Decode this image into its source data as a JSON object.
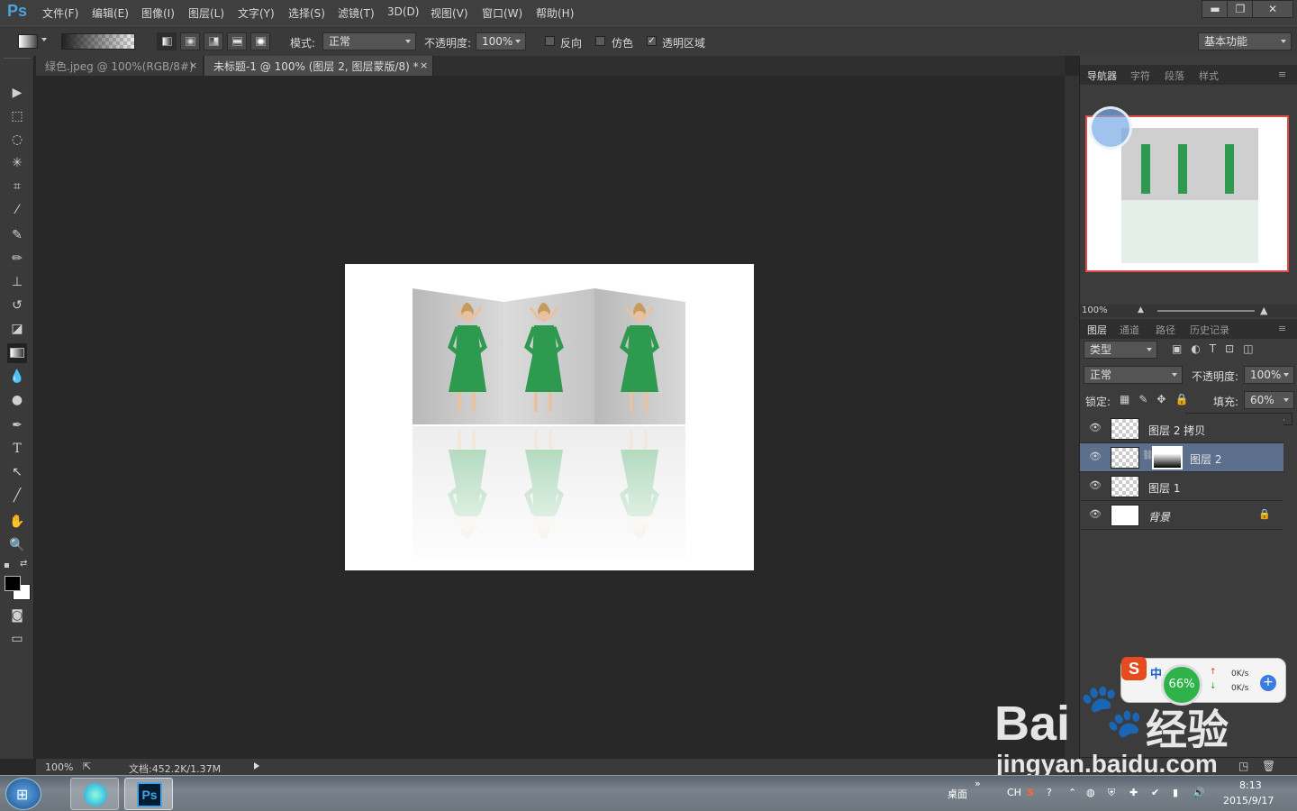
{
  "app": {
    "logo": "Ps"
  },
  "menu": [
    "文件(F)",
    "编辑(E)",
    "图像(I)",
    "图层(L)",
    "文字(Y)",
    "选择(S)",
    "滤镜(T)",
    "3D(D)",
    "视图(V)",
    "窗口(W)",
    "帮助(H)"
  ],
  "window_buttons": {
    "minimize": "▬",
    "restore": "❐",
    "close": "✕"
  },
  "options": {
    "mode_label": "模式:",
    "mode_value": "正常",
    "opacity_label": "不透明度:",
    "opacity_value": "100%",
    "reverse_label": "反向",
    "dither_label": "仿色",
    "transparency_label": "透明区域",
    "workspace": "基本功能"
  },
  "tabs": [
    {
      "label": "绿色.jpeg @ 100%(RGB/8#)",
      "close": "×"
    },
    {
      "label": "未标题-1 @ 100% (图层 2, 图层蒙版/8) *",
      "close": "×"
    }
  ],
  "status": {
    "zoom": "100%",
    "doc_info": "文档:452.2K/1.37M"
  },
  "panels": {
    "top_tabs": [
      "导航器",
      "字符",
      "段落",
      "样式"
    ],
    "nav_zoom": "100%",
    "layer_tabs": [
      "图层",
      "通道",
      "路径",
      "历史记录"
    ],
    "filter_kind": "类型",
    "blend_mode": "正常",
    "opacity_label": "不透明度:",
    "opacity_value": "100%",
    "lock_label": "锁定:",
    "fill_label": "填充:",
    "fill_value": "60%"
  },
  "layers": [
    {
      "name": "图层 2 拷贝",
      "selected": false,
      "mask": false,
      "locked": false
    },
    {
      "name": "图层 2",
      "selected": true,
      "mask": true,
      "locked": false
    },
    {
      "name": "图层 1",
      "selected": false,
      "mask": false,
      "locked": false
    },
    {
      "name": "背景",
      "selected": false,
      "mask": false,
      "locked": true
    }
  ],
  "widget": {
    "percent": "66%",
    "up": "0K/s",
    "down": "0K/s",
    "ime": "中"
  },
  "watermark": {
    "brand": "Bai",
    "brand2": "经验",
    "url": "jingyan.baidu.com"
  },
  "taskbar": {
    "desktop": "桌面",
    "lang": "CH",
    "time": "8:13",
    "date": "2015/9/17"
  },
  "colors": {
    "accent": "#4aa2e0",
    "selection": "#5c6f8c",
    "nav_border": "#e04a4a",
    "dress": "#2e9a50",
    "widget_green": "#2db34a"
  }
}
